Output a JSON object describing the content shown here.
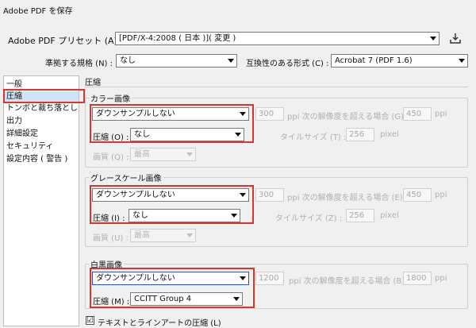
{
  "window": {
    "title": "Adobe PDF を保存"
  },
  "preset": {
    "label": "Adobe PDF プリセット (A) :",
    "value": "[PDF/X-4:2008 ( 日本 )]( 変更 )"
  },
  "standard": {
    "label": "準拠する規格 (N) :",
    "value": "なし"
  },
  "compat": {
    "label": "互換性のある形式 (C) :",
    "value": "Acrobat 7 (PDF 1.6)"
  },
  "sidebar": {
    "items": [
      {
        "label": "一般"
      },
      {
        "label": "圧縮"
      },
      {
        "label": "トンボと裁ち落とし"
      },
      {
        "label": "出力"
      },
      {
        "label": "詳細設定"
      },
      {
        "label": "セキュリティ"
      },
      {
        "label": "設定内容 ( 警告 )"
      }
    ]
  },
  "section": {
    "title": "圧縮"
  },
  "color_images": {
    "title": "カラー画像",
    "downsample": "ダウンサンプルしない",
    "ppi_value": "300",
    "ppi_label": "ppi 次の解像度を超える場合 (G)",
    "threshold": "450",
    "threshold_unit": "ppi",
    "compression_label": "圧縮 (O) :",
    "compression": "なし",
    "tile_label": "タイルサイズ (T) :",
    "tile_value": "256",
    "tile_unit": "pixel",
    "quality_label": "画質 (Q) :",
    "quality": "最高"
  },
  "gray_images": {
    "title": "グレースケール画像",
    "downsample": "ダウンサンプルしない",
    "ppi_value": "300",
    "ppi_label": "ppi 次の解像度を超える場合 (E)",
    "threshold": "450",
    "threshold_unit": "ppi",
    "compression_label": "圧縮 (I) :",
    "compression": "なし",
    "tile_label": "タイルサイズ (Z) :",
    "tile_value": "256",
    "tile_unit": "pixel",
    "quality_label": "画質 (U) :",
    "quality": "最高"
  },
  "mono_images": {
    "title": "白黒画像",
    "downsample": "ダウンサンプルしない",
    "ppi_value": "1200",
    "ppi_label": "ppi 次の解像度を超える場合 (B)",
    "threshold": "1800",
    "threshold_unit": "ppi",
    "compression_label": "圧縮 (M) :",
    "compression": "CCITT Group 4"
  },
  "text_art": {
    "label": "テキストとラインアートの圧縮 (L)",
    "checked": "☑"
  },
  "colors": {
    "highlight": "#e0332b",
    "selection": "#cde6f7"
  }
}
